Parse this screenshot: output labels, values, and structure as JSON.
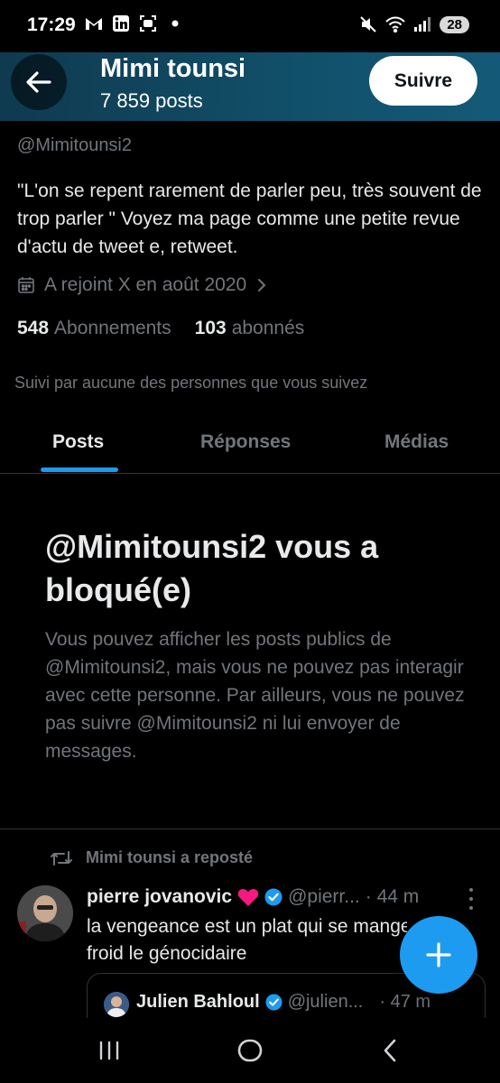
{
  "status_bar": {
    "time": "17:29",
    "battery": "28",
    "left_icons": [
      "gmail-icon",
      "linkedin-icon",
      "screen-record-icon",
      "dot-icon"
    ],
    "right_icons": [
      "mute-icon",
      "wifi-icon",
      "signal-icon"
    ]
  },
  "header": {
    "name": "Mimi tounsi",
    "posts_count": "7 859 posts",
    "follow_label": "Suivre"
  },
  "profile": {
    "handle": "@Mimitounsi2",
    "bio": "\"L'on se repent rarement de parler peu, très souvent de trop parler \" Voyez ma page comme une petite revue d'actu de tweet e, retweet.",
    "joined": "A rejoint X en août 2020",
    "following_count": "548",
    "following_label": "Abonnements",
    "followers_count": "103",
    "followers_label": "abonnés",
    "followed_by": "Suivi par aucune des personnes que vous suivez"
  },
  "tabs": [
    {
      "label": "Posts",
      "active": true
    },
    {
      "label": "Réponses",
      "active": false
    },
    {
      "label": "Médias",
      "active": false
    }
  ],
  "blocked": {
    "title": "@Mimitounsi2 vous a bloqué(e)",
    "text": "Vous pouvez afficher les posts publics de @Mimitounsi2, mais vous ne pouvez pas interagir avec cette personne. Par ailleurs, vous ne pouvez pas suivre @Mimitounsi2 ni lui envoyer de messages."
  },
  "tweet": {
    "repost_label": "Mimi tounsi a reposté",
    "author_name": "pierre jovanovic",
    "author_handle": "@pierr...",
    "time": "· 44 m",
    "line1": "la vengeance est un plat qui se mange",
    "line2": "froid  le génocidaire",
    "quote": {
      "author_name": "Julien Bahloul",
      "author_handle": "@julien...",
      "time": "· 47 m"
    }
  },
  "colors": {
    "accent": "#1d9bf0",
    "muted": "#71767b",
    "heart": "#f91880"
  }
}
